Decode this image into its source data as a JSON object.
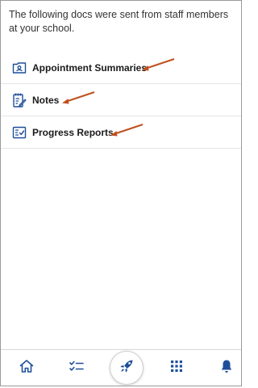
{
  "intro_text": "The following docs were sent from staff members at your school.",
  "documents": [
    {
      "label": "Appointment Summaries",
      "icon": "id-card-icon"
    },
    {
      "label": "Notes",
      "icon": "notes-icon"
    },
    {
      "label": "Progress Reports",
      "icon": "report-checklist-icon"
    }
  ],
  "bottom_nav": [
    {
      "icon": "home-icon"
    },
    {
      "icon": "checklist-icon"
    },
    {
      "icon": "rocket-icon"
    },
    {
      "icon": "apps-grid-icon"
    },
    {
      "icon": "bell-icon"
    }
  ],
  "colors": {
    "icon_blue": "#1f4f9a",
    "arrow": "#c0501e",
    "text": "#1a1a1a"
  }
}
